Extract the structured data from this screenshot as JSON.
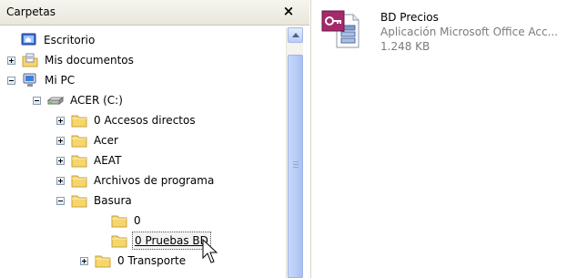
{
  "folders_pane": {
    "title": "Carpetas",
    "close_glyph": "×"
  },
  "tree": [
    {
      "label": "Escritorio",
      "icon": "desktop-icon",
      "expander": "none",
      "selected": false
    },
    {
      "label": "Mis documentos",
      "icon": "my-documents-icon",
      "expander": "plus",
      "selected": false
    },
    {
      "label": "Mi PC",
      "icon": "my-computer-icon",
      "expander": "minus",
      "selected": false
    },
    {
      "label": "ACER (C:)",
      "icon": "drive-icon",
      "expander": "minus",
      "selected": false
    },
    {
      "label": "0 Accesos directos",
      "icon": "folder-icon",
      "expander": "plus",
      "selected": false
    },
    {
      "label": "Acer",
      "icon": "folder-icon",
      "expander": "plus",
      "selected": false
    },
    {
      "label": "AEAT",
      "icon": "folder-icon",
      "expander": "plus",
      "selected": false
    },
    {
      "label": "Archivos de programa",
      "icon": "folder-icon",
      "expander": "plus",
      "selected": false
    },
    {
      "label": "Basura",
      "icon": "folder-icon",
      "expander": "minus",
      "selected": false
    },
    {
      "label": "0",
      "icon": "folder-icon",
      "expander": "none",
      "selected": false
    },
    {
      "label": "0 Pruebas BD",
      "icon": "folder-icon",
      "expander": "none",
      "selected": true
    },
    {
      "label": "0 Transporte",
      "icon": "folder-icon",
      "expander": "plus",
      "selected": false
    }
  ],
  "file": {
    "name": "BD Precios",
    "type": "Aplicación Microsoft Office Acc...",
    "size": "1.248 KB",
    "icon": "access-database-icon"
  },
  "colors": {
    "folder": "#f6d66b",
    "folder_edge": "#c9a13a",
    "selection_border": "#555555"
  }
}
